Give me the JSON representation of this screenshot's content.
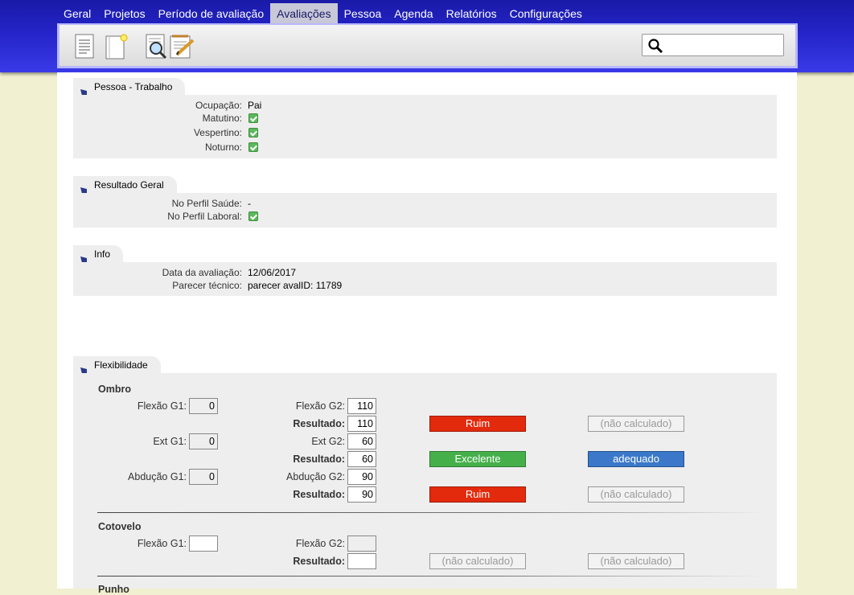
{
  "nav": {
    "items": [
      "Geral",
      "Projetos",
      "Período de avaliação",
      "Avaliações",
      "Pessoa",
      "Agenda",
      "Relatórios",
      "Configurações"
    ],
    "active": "Avaliações"
  },
  "toolbar": {
    "icons": [
      "document-list-icon",
      "new-document-icon",
      "search-document-icon",
      "edit-notepad-icon"
    ],
    "search_value": ""
  },
  "sections": {
    "trabalho": {
      "title": "Pessoa - Trabalho",
      "rows": [
        {
          "label": "Ocupação:",
          "value": "Pai"
        },
        {
          "label": "Matutino:",
          "check": true
        },
        {
          "label": "Vespertino:",
          "check": true
        },
        {
          "label": "Noturno:",
          "check": true
        }
      ]
    },
    "resultado": {
      "title": "Resultado Geral",
      "rows": [
        {
          "label": "No Perfil Saúde:",
          "value": "-"
        },
        {
          "label": "No Perfil Laboral:",
          "check": true
        }
      ]
    },
    "info": {
      "title": "Info",
      "rows": [
        {
          "label": "Data da avaliação:",
          "value": "12/06/2017"
        },
        {
          "label": "Parecer técnico:",
          "value": "parecer avalID: 11789"
        }
      ]
    },
    "flex": {
      "title": "Flexibilidade",
      "ombro": {
        "title": "Ombro",
        "flexao_g1_label": "Flexão G1:",
        "flexao_g1": "0",
        "flexao_g2_label": "Flexão G2:",
        "flexao_g2": "110",
        "res1_label": "Resultado:",
        "res1": "110",
        "res1_class": "Ruim",
        "res1_status": "(não calculado)",
        "ext_g1_label": "Ext G1:",
        "ext_g1": "0",
        "ext_g2_label": "Ext G2:",
        "ext_g2": "60",
        "res2_label": "Resultado:",
        "res2": "60",
        "res2_class": "Excelente",
        "res2_status": "adequado",
        "abd_g1_label": "Abdução G1:",
        "abd_g1": "0",
        "abd_g2_label": "Abdução G2:",
        "abd_g2": "90",
        "res3_label": "Resultado:",
        "res3": "90",
        "res3_class": "Ruim",
        "res3_status": "(não calculado)"
      },
      "cotovelo": {
        "title": "Cotovelo",
        "flexao_g1_label": "Flexão G1:",
        "flexao_g1": "",
        "flexao_g2_label": "Flexão G2:",
        "flexao_g2": "",
        "res_label": "Resultado:",
        "res": "",
        "res_class": "(não calculado)",
        "res_status": "(não calculado)"
      },
      "punho": {
        "title": "Punho"
      }
    }
  },
  "colors": {
    "header_blue": "#2424c8",
    "ruim": "#e32a0c",
    "excelente": "#45b04a",
    "adequado": "#3b78c9"
  }
}
